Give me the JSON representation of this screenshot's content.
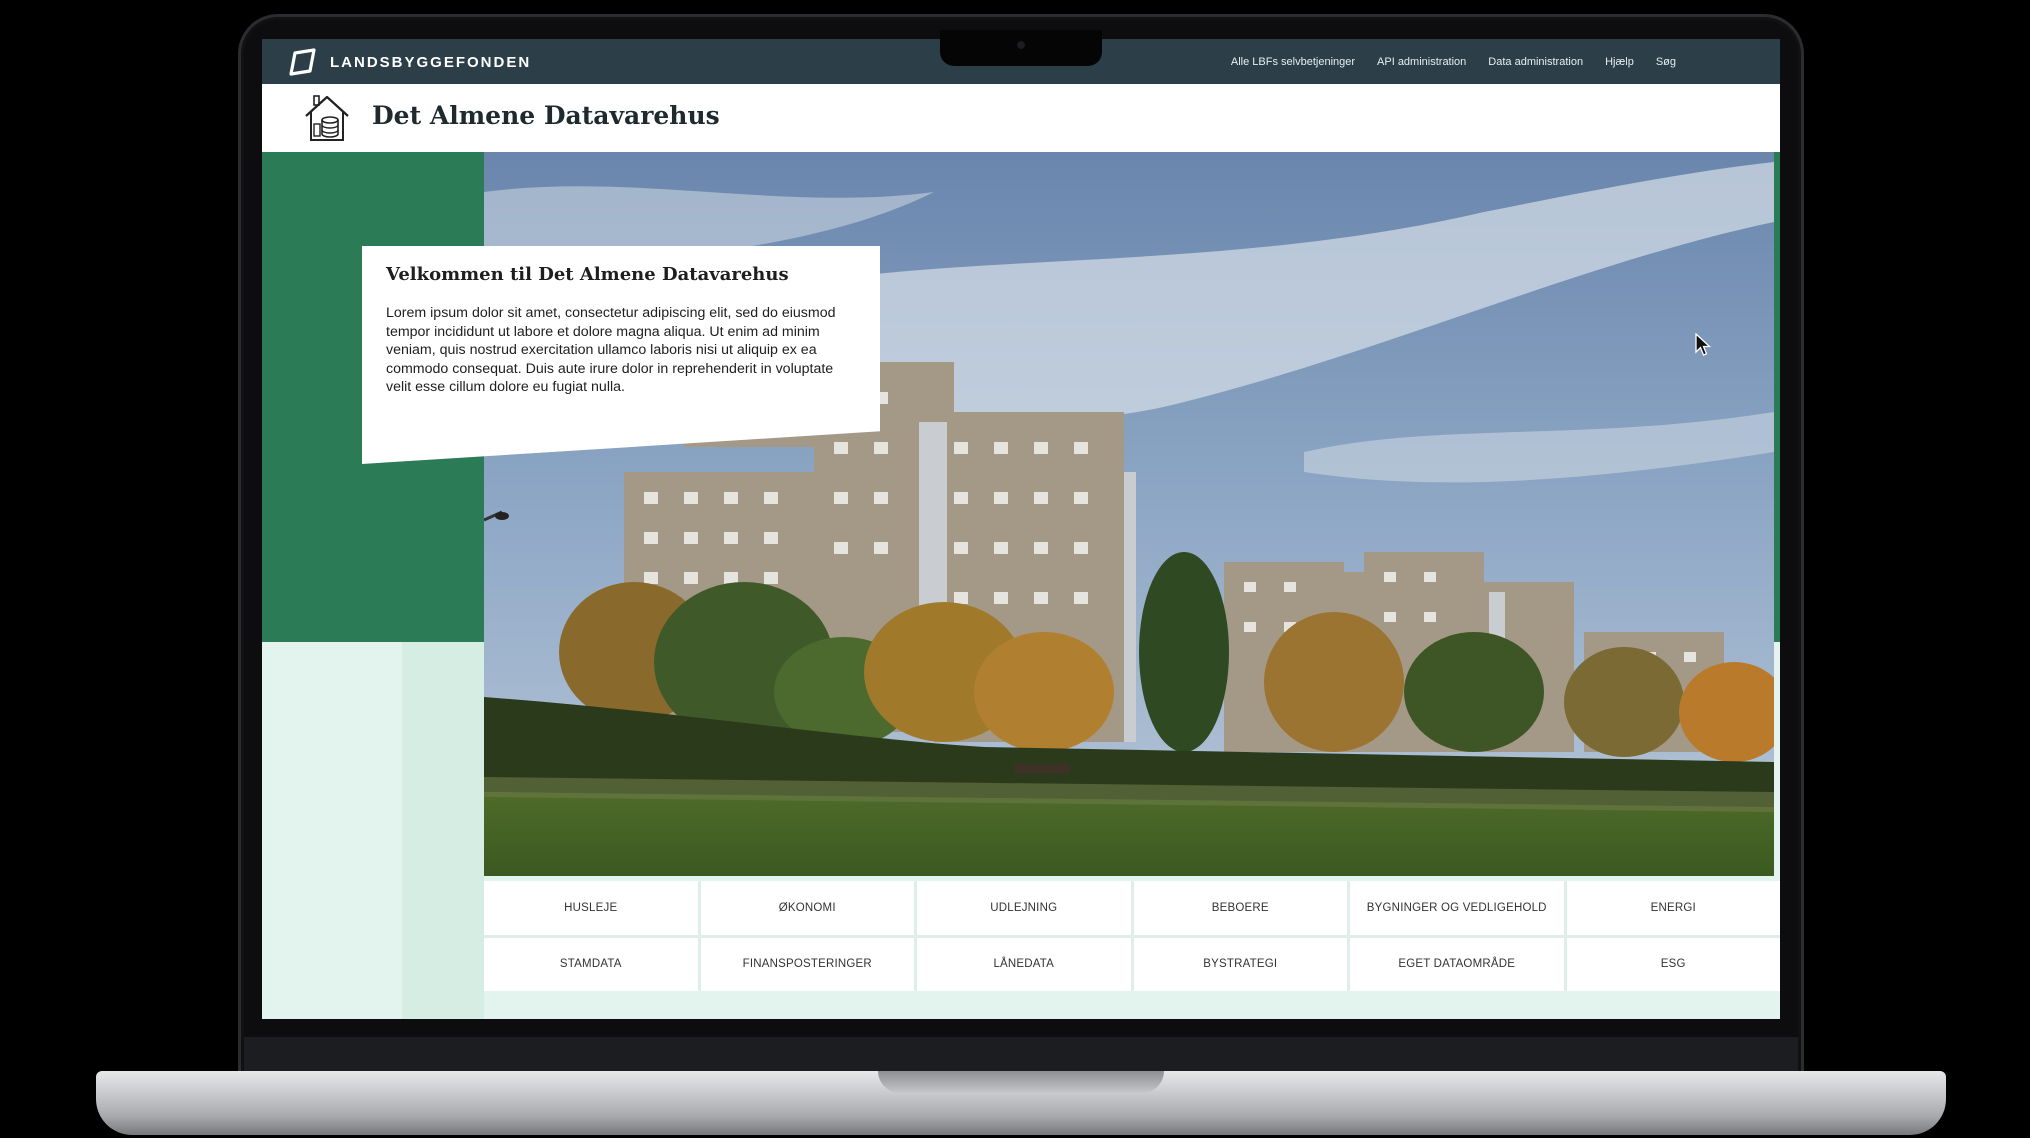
{
  "topbar": {
    "brand": "LANDSBYGGEFONDEN",
    "nav": [
      "Alle LBFs selvbetjeninger",
      "API administration",
      "Data administration",
      "Hjælp",
      "Søg"
    ]
  },
  "header": {
    "title": "Det Almene Datavarehus"
  },
  "welcome": {
    "title": "Velkommen til Det Almene Datavarehus",
    "body": "Lorem ipsum dolor sit amet, consectetur adipiscing elit, sed do eiusmod tempor incididunt ut labore et dolore magna aliqua. Ut enim ad minim veniam, quis nostrud exercitation ullamco laboris nisi ut aliquip ex ea commodo consequat. Duis aute irure dolor in reprehenderit in voluptate velit esse cillum dolore eu fugiat nulla."
  },
  "categories": [
    "HUSLEJE",
    "ØKONOMI",
    "UDLEJNING",
    "BEBOERE",
    "BYGNINGER OG VEDLIGEHOLD",
    "ENERGI",
    "STAMDATA",
    "FINANSPOSTERINGER",
    "LÅNEDATA",
    "BYSTRATEGI",
    "EGET DATAOMRÅDE",
    "ESG"
  ],
  "colors": {
    "topbar": "#2c3e48",
    "brand_green": "#2a7b56",
    "mint": "#e3f4ee"
  }
}
